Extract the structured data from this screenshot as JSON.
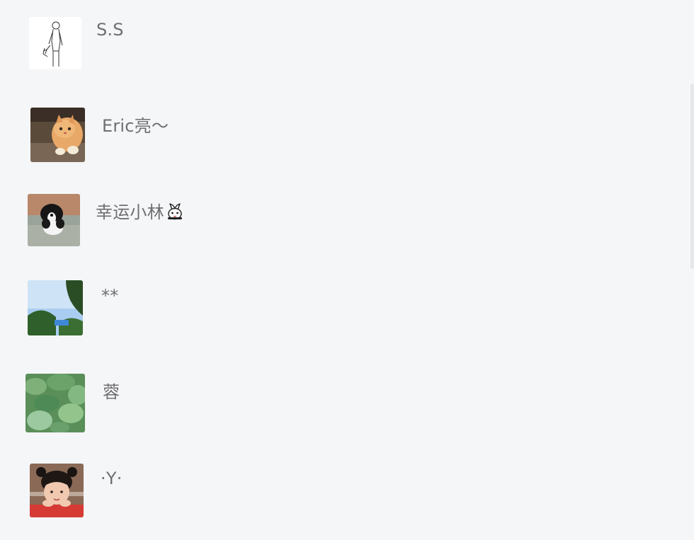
{
  "contacts": [
    {
      "name": "S.S",
      "avatar": "sketch-figure-avatar",
      "accent": "#222222"
    },
    {
      "name": "Eric亮～",
      "avatar": "orange-cat-avatar",
      "accent": "#e0a060"
    },
    {
      "name": "幸运小林",
      "avatar": "puppy-avatar",
      "emoji": "rabbit-icon",
      "accent": "#1b1b1b"
    },
    {
      "name": "**",
      "avatar": "sky-trees-avatar",
      "accent": "#5b9ee0"
    },
    {
      "name": "蓉",
      "avatar": "lotus-leaves-avatar",
      "accent": "#4e9a5a"
    },
    {
      "name": "·Y·",
      "avatar": "girl-portrait-avatar",
      "accent": "#d6453b"
    }
  ],
  "colors": {
    "background": "#f5f6f8",
    "name_text": "#6f6f72"
  }
}
